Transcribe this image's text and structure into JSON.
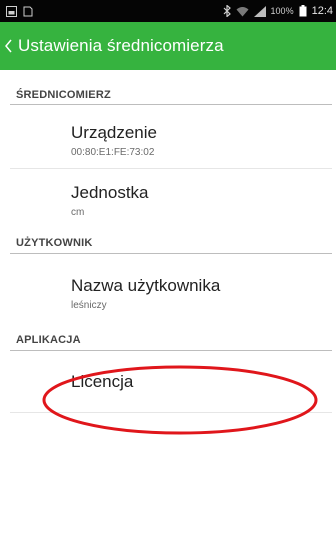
{
  "status_bar": {
    "time": "12:4",
    "battery_percent": "100%",
    "icons": [
      "screenshot-icon",
      "notification-icon",
      "bluetooth-icon",
      "wifi-icon",
      "signal-icon",
      "battery-icon"
    ]
  },
  "action_bar": {
    "title": "Ustawienia średnicomierza",
    "background_color": "#36b33f"
  },
  "sections": [
    {
      "header": "ŚREDNICOMIERZ",
      "items": [
        {
          "title": "Urządzenie",
          "summary": "00:80:E1:FE:73:02"
        },
        {
          "title": "Jednostka",
          "summary": "cm"
        }
      ]
    },
    {
      "header": "UŻYTKOWNIK",
      "items": [
        {
          "title": "Nazwa użytkownika",
          "summary": "leśniczy"
        }
      ]
    },
    {
      "header": "APLIKACJA",
      "items": [
        {
          "title": "Licencja"
        }
      ]
    }
  ],
  "annotation": {
    "shape": "ellipse",
    "color": "#e0161b",
    "target": "Licencja"
  }
}
